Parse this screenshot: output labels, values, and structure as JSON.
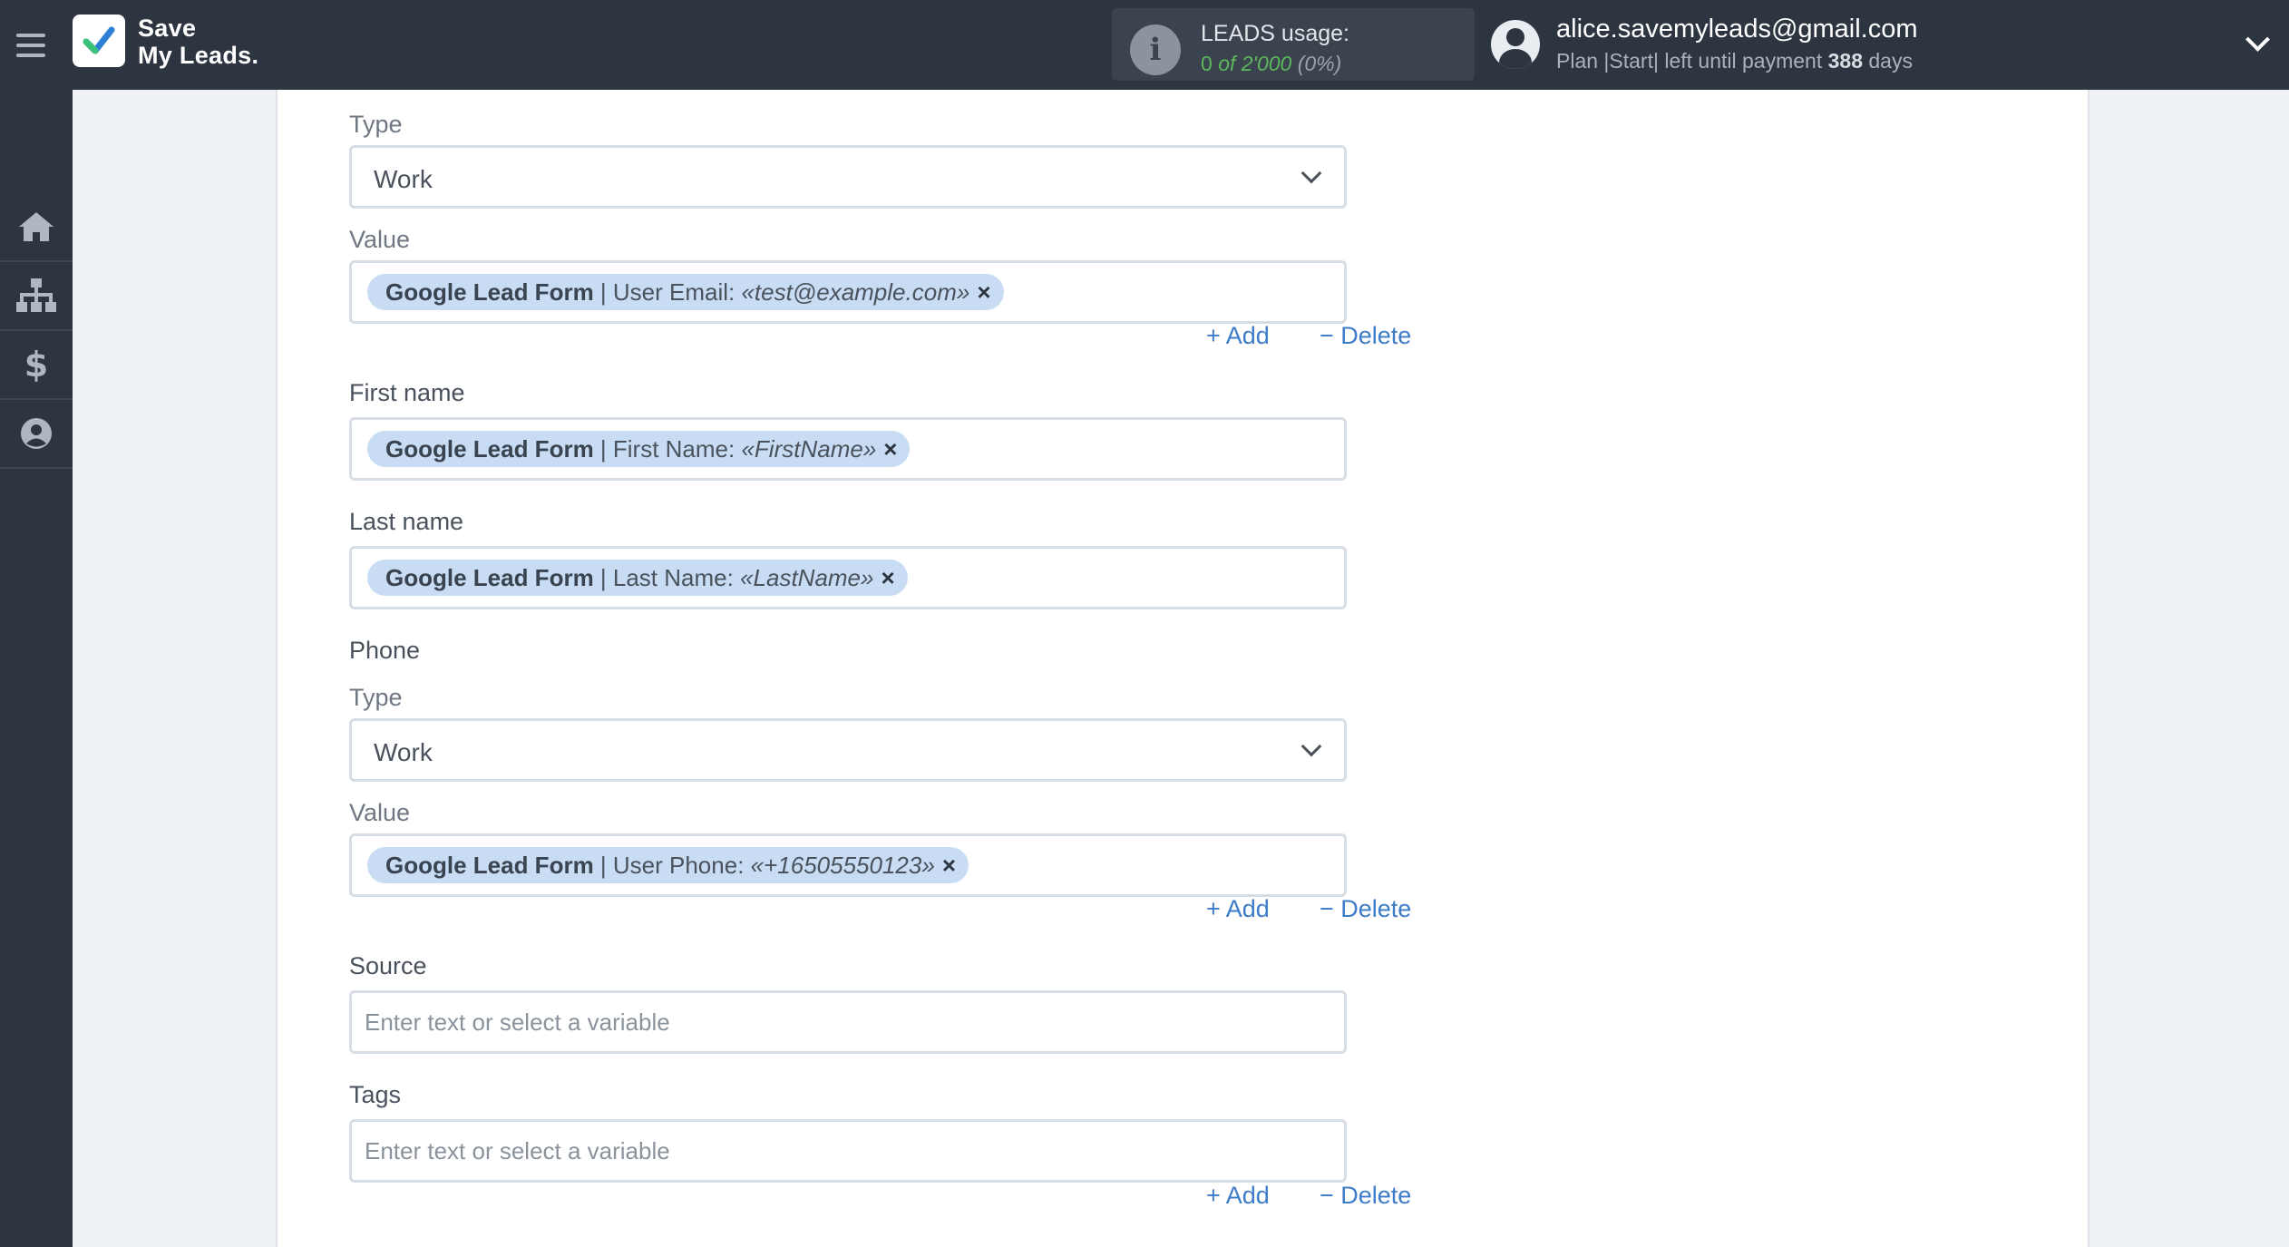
{
  "header": {
    "logo_line1": "Save",
    "logo_line2": "My Leads.",
    "usage_title": "LEADS usage:",
    "usage_used": "0",
    "usage_of": "of 2'000",
    "usage_pct": "(0%)",
    "email": "alice.savemyleads@gmail.com",
    "plan_prefix": "Plan |Start| left until payment",
    "plan_days": "388",
    "plan_suffix": "days"
  },
  "sidebar": {
    "items": [
      "home-icon",
      "sitemap-icon",
      "dollar-icon",
      "user-icon"
    ],
    "dollar_glyph": "$"
  },
  "form": {
    "email_type_label": "Type",
    "email_type_value": "Work",
    "email_value_label": "Value",
    "email_chip": {
      "source": "Google Lead Form",
      "sep": " | ",
      "field": "User Email: ",
      "sample": "«test@example.com»"
    },
    "add_label": "+ Add",
    "delete_label": "− Delete",
    "first_name_label": "First name",
    "first_name_chip": {
      "source": "Google Lead Form",
      "sep": " | ",
      "field": "First Name: ",
      "sample": "«FirstName»"
    },
    "last_name_label": "Last name",
    "last_name_chip": {
      "source": "Google Lead Form",
      "sep": " | ",
      "field": "Last Name: ",
      "sample": "«LastName»"
    },
    "phone_label": "Phone",
    "phone_type_label": "Type",
    "phone_type_value": "Work",
    "phone_value_label": "Value",
    "phone_chip": {
      "source": "Google Lead Form",
      "sep": " | ",
      "field": "User Phone: ",
      "sample": "«+16505550123»"
    },
    "source_label": "Source",
    "source_placeholder": "Enter text or select a variable",
    "tags_label": "Tags",
    "tags_placeholder": "Enter text or select a variable"
  },
  "colors": {
    "header_bg": "#2d3540",
    "accent_blue": "#3d7cc9",
    "chip_bg": "#c8dcf4",
    "usage_green": "#5cb85c"
  }
}
